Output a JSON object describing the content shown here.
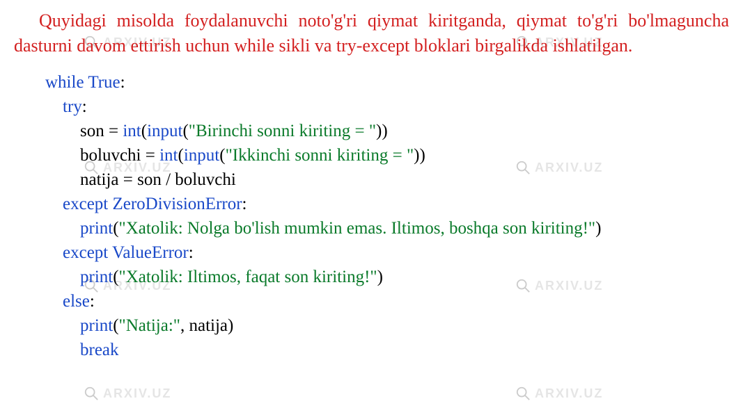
{
  "watermark_text": "ARXIV.UZ",
  "intro": "Quyidagi misolda foydalanuvchi noto'g'ri qiymat kiritganda, qiymat to'g'ri bo'lmaguncha dasturni davom ettirish uchun while sikli va try-except bloklari birgalikda ishlatilgan.",
  "code": {
    "l1_kw": "while True",
    "l1_colon": ":",
    "l2_kw": "try",
    "l2_colon": ":",
    "l3_var": "son = ",
    "l3_fn1": "int",
    "l3_p1": "(",
    "l3_fn2": "input",
    "l3_p2": "(",
    "l3_str": "\"Birinchi sonni kiriting = \"",
    "l3_end": "))",
    "l4_var": "boluvchi = ",
    "l4_fn1": "int",
    "l4_p1": "(",
    "l4_fn2": "input",
    "l4_p2": "(",
    "l4_str": "\"Ikkinchi sonni kiriting = \"",
    "l4_end": "))",
    "l5": "natija = son / boluvchi",
    "l6_kw": "except",
    "l6_sp": " ",
    "l6_cls": "ZeroDivisionError",
    "l6_colon": ":",
    "l7_fn": "print",
    "l7_p1": "(",
    "l7_str": "\"Xatolik: Nolga bo'lish mumkin emas. Iltimos, boshqa son kiriting!\"",
    "l7_end": ")",
    "l8_kw": "except",
    "l8_sp": " ",
    "l8_cls": "ValueError",
    "l8_colon": ":",
    "l9_fn": "print",
    "l9_p1": "(",
    "l9_str": "\"Xatolik: Iltimos, faqat son kiriting!\"",
    "l9_end": ")",
    "l10_kw": "else",
    "l10_colon": ":",
    "l11_fn": "print",
    "l11_p1": "(",
    "l11_str": "\"Natija:\"",
    "l11_rest": ", natija)",
    "l12_kw": "break"
  }
}
